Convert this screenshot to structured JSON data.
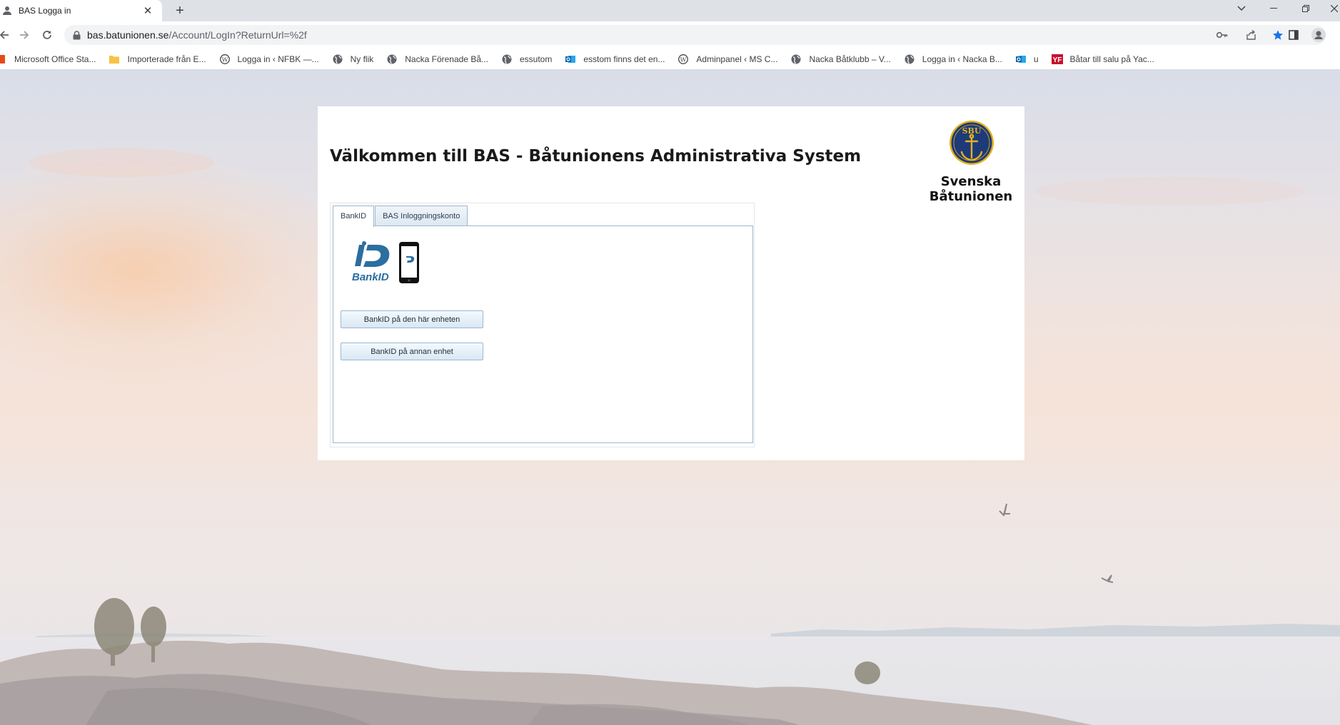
{
  "browser": {
    "tab_title": "BAS Logga in",
    "new_tab_label": "+",
    "url_host": "bas.batunionen.se",
    "url_path": "/Account/LogIn?ReturnUrl=%2f"
  },
  "bookmarks": [
    {
      "label": "Microsoft Office Sta...",
      "icon": "office-icon"
    },
    {
      "label": "Importerade från E...",
      "icon": "folder-icon"
    },
    {
      "label": "Logga in ‹ NFBK —...",
      "icon": "wordpress-icon"
    },
    {
      "label": "Ny flik",
      "icon": "globe-icon"
    },
    {
      "label": "Nacka Förenade Bå...",
      "icon": "globe-icon"
    },
    {
      "label": "essutom",
      "icon": "globe-icon"
    },
    {
      "label": "esstom finns det en...",
      "icon": "outlook-icon"
    },
    {
      "label": "Adminpanel ‹ MS C...",
      "icon": "wordpress-icon"
    },
    {
      "label": "Nacka Båtklubb – V...",
      "icon": "globe-icon"
    },
    {
      "label": "Logga in ‹ Nacka B...",
      "icon": "globe-icon"
    },
    {
      "label": "u",
      "icon": "outlook-icon"
    },
    {
      "label": "Båtar till salu på Yac...",
      "icon": "yf-icon"
    }
  ],
  "page": {
    "title": "Välkommen till BAS - Båtunionens Administrativa System",
    "logo_line1": "Svenska",
    "logo_line2": "Båtunionen",
    "logo_badge": "SBU",
    "tabs": [
      {
        "label": "BankID",
        "active": true
      },
      {
        "label": "BAS Inloggningskonto",
        "active": false
      }
    ],
    "bankid_logo_text": "BankID",
    "buttons": {
      "this_device": "BankID på den här enheten",
      "other_device": "BankID på annan enhet"
    }
  },
  "colors": {
    "accent_star": "#1a73e8",
    "tab_border": "#9bb8cf",
    "bankid_blue": "#2b6ea0",
    "sbu_navy": "#1e3a78",
    "sbu_gold": "#e3b21c"
  }
}
